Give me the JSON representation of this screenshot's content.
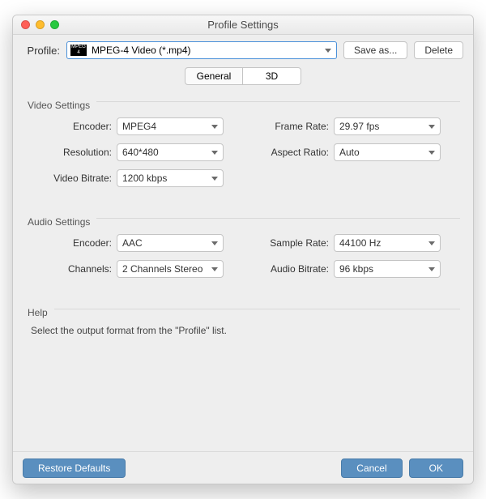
{
  "window": {
    "title": "Profile Settings"
  },
  "top": {
    "profile_label": "Profile:",
    "profile_value": "MPEG-4 Video (*.mp4)",
    "save_as": "Save as...",
    "delete": "Delete"
  },
  "tabs": {
    "general": "General",
    "three_d": "3D"
  },
  "video": {
    "title": "Video Settings",
    "encoder_label": "Encoder:",
    "encoder_value": "MPEG4",
    "framerate_label": "Frame Rate:",
    "framerate_value": "29.97 fps",
    "resolution_label": "Resolution:",
    "resolution_value": "640*480",
    "aspect_label": "Aspect Ratio:",
    "aspect_value": "Auto",
    "bitrate_label": "Video Bitrate:",
    "bitrate_value": "1200 kbps"
  },
  "audio": {
    "title": "Audio Settings",
    "encoder_label": "Encoder:",
    "encoder_value": "AAC",
    "samplerate_label": "Sample Rate:",
    "samplerate_value": "44100 Hz",
    "channels_label": "Channels:",
    "channels_value": "2 Channels Stereo",
    "bitrate_label": "Audio Bitrate:",
    "bitrate_value": "96 kbps"
  },
  "help": {
    "title": "Help",
    "text": "Select the output format from the \"Profile\" list."
  },
  "bottom": {
    "restore": "Restore Defaults",
    "cancel": "Cancel",
    "ok": "OK"
  }
}
